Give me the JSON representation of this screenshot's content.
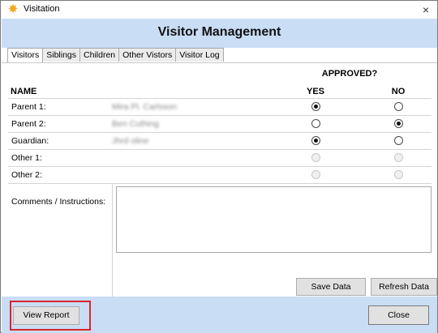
{
  "window": {
    "title": "Visitation",
    "close_glyph": "×",
    "icon": "sun-icon",
    "icon_glyph": "✸"
  },
  "header": {
    "title": "Visitor Management"
  },
  "tabs": [
    {
      "label": "Visitors",
      "active": true
    },
    {
      "label": "Siblings",
      "active": false
    },
    {
      "label": "Children",
      "active": false
    },
    {
      "label": "Other Vistors",
      "active": false
    },
    {
      "label": "Visitor Log",
      "active": false
    }
  ],
  "table": {
    "approved_header": "APPROVED?",
    "name_header": "NAME",
    "yes_header": "YES",
    "no_header": "NO",
    "rows": [
      {
        "label": "Parent 1:",
        "name": "Mira Pl. Carlsson",
        "yes": true,
        "no": false,
        "enabled": true
      },
      {
        "label": "Parent 2:",
        "name": "Ben Cuthing",
        "yes": false,
        "no": true,
        "enabled": true
      },
      {
        "label": "Guardian:",
        "name": "Jhrd oline",
        "yes": true,
        "no": false,
        "enabled": true
      },
      {
        "label": "Other 1:",
        "name": "",
        "yes": false,
        "no": false,
        "enabled": false
      },
      {
        "label": "Other 2:",
        "name": "",
        "yes": false,
        "no": false,
        "enabled": false
      }
    ]
  },
  "comments": {
    "label": "Comments / Instructions:",
    "value": ""
  },
  "buttons": {
    "save": "Save Data",
    "refresh": "Refresh Data",
    "view_report": "View Report",
    "close": "Close"
  },
  "colors": {
    "band": "#c9ddf5",
    "highlight": "#d9262c",
    "icon": "#f5a623"
  }
}
